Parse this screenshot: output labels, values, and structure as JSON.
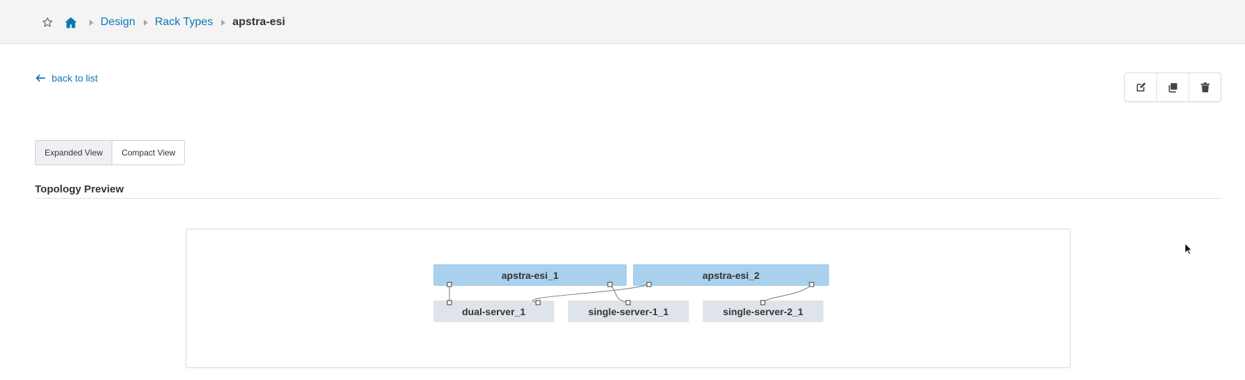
{
  "breadcrumb": {
    "items": [
      {
        "label": "Design"
      },
      {
        "label": "Rack Types"
      }
    ],
    "current": "apstra-esi"
  },
  "back_link": "back to list",
  "view_toggle": {
    "options": [
      "Expanded View",
      "Compact View"
    ],
    "selected": "Expanded View"
  },
  "section": {
    "title": "Topology Preview"
  },
  "topology": {
    "leafs": [
      "apstra-esi_1",
      "apstra-esi_2"
    ],
    "generic_systems": [
      "dual-server_1",
      "single-server-1_1",
      "single-server-2_1"
    ]
  },
  "colors": {
    "link": "#0a78b7",
    "leaf": "#a9d0ec",
    "generic": "#dfe4ea"
  }
}
